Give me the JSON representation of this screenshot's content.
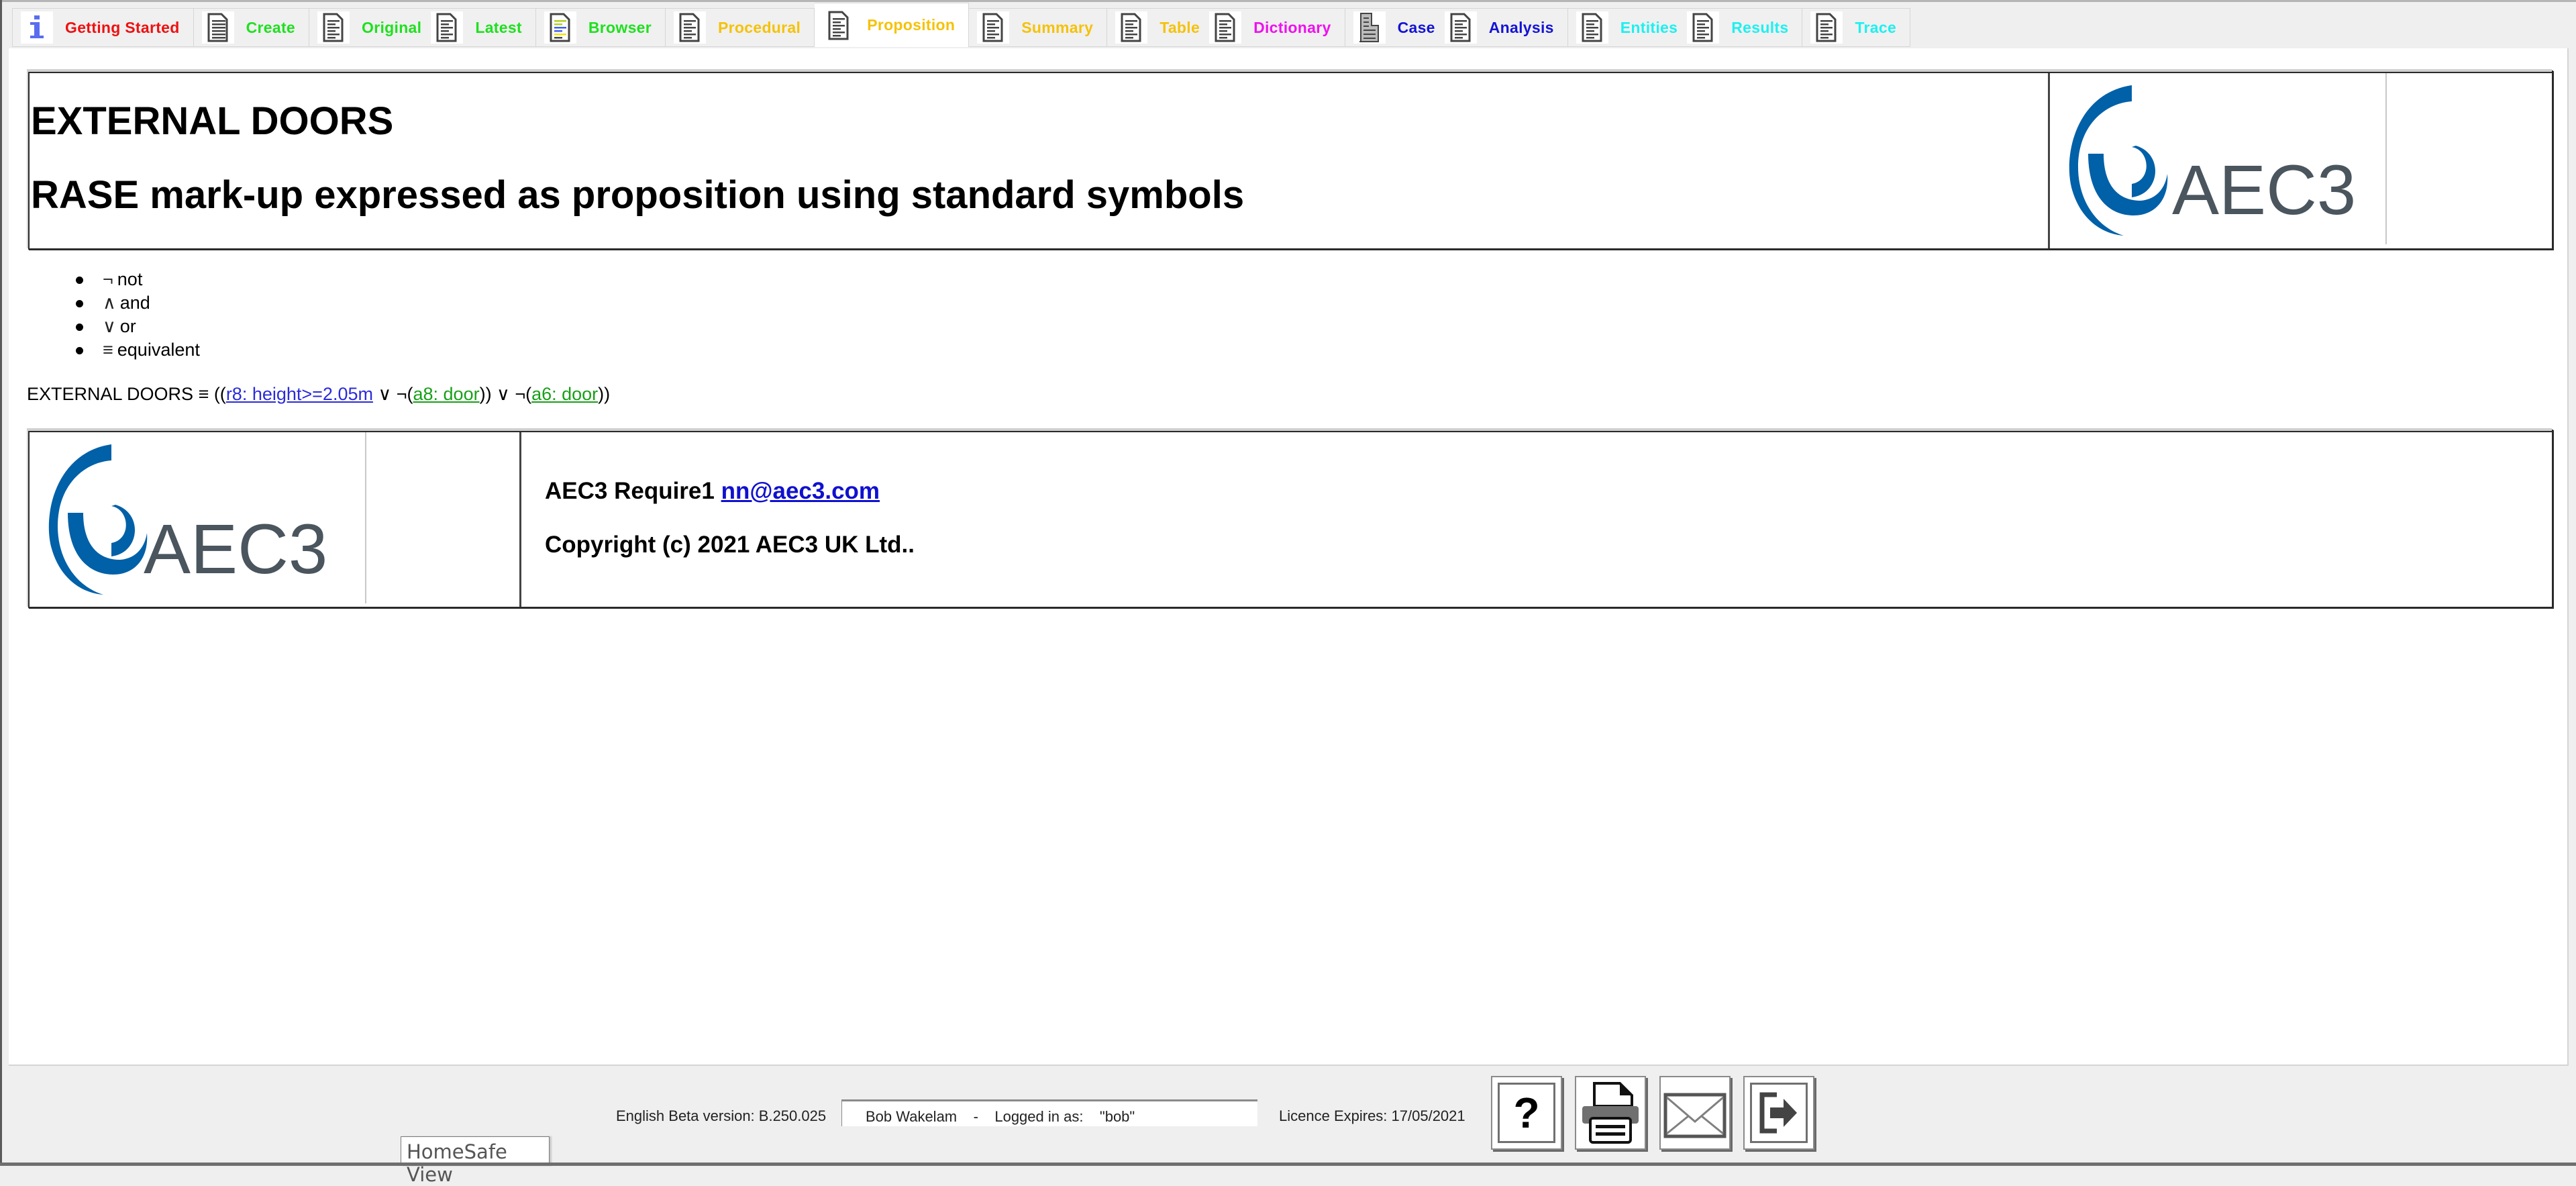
{
  "tabs": [
    {
      "label": "Getting Started",
      "icon": "info-icon",
      "color": "#ee1111",
      "group": 0
    },
    {
      "label": "Create",
      "icon": "calculator-document-icon",
      "color": "#1fe01f",
      "group": 1
    },
    {
      "label": "Original",
      "icon": "document-icon",
      "color": "#1fe01f",
      "group": 2
    },
    {
      "label": "Latest",
      "icon": "document-icon",
      "color": "#1fe01f",
      "group": 2
    },
    {
      "label": "Browser",
      "icon": "colored-document-icon",
      "color": "#1fe01f",
      "group": 3
    },
    {
      "label": "Procedural",
      "icon": "document-icon",
      "color": "#f5c20a",
      "group": 4
    },
    {
      "label": "Proposition",
      "icon": "document-icon",
      "color": "#f5c20a",
      "group": 5,
      "active": true
    },
    {
      "label": "Summary",
      "icon": "document-icon",
      "color": "#f5c20a",
      "group": 6
    },
    {
      "label": "Table",
      "icon": "table-document-icon",
      "color": "#f5c20a",
      "group": 7
    },
    {
      "label": "Dictionary",
      "icon": "dictionary-document-icon",
      "color": "#ee11ee",
      "group": 7
    },
    {
      "label": "Case",
      "icon": "building-icon",
      "color": "#1414d4",
      "group": 8
    },
    {
      "label": "Analysis",
      "icon": "analysis-document-icon",
      "color": "#1414d4",
      "group": 8
    },
    {
      "label": "Entities",
      "icon": "list-document-icon",
      "color": "#1ef0f0",
      "group": 9
    },
    {
      "label": "Results",
      "icon": "list-document-icon",
      "color": "#1ef0f0",
      "group": 9
    },
    {
      "label": "Trace",
      "icon": "list-document-icon",
      "color": "#1ef0f0",
      "group": 10
    }
  ],
  "header": {
    "title": "EXTERNAL DOORS",
    "subtitle": "RASE mark-up expressed as proposition using standard symbols",
    "logo_text": "AEC3"
  },
  "legend": [
    {
      "symbol": "¬",
      "meaning": "not"
    },
    {
      "symbol": "∧",
      "meaning": "and"
    },
    {
      "symbol": "∨",
      "meaning": "or"
    },
    {
      "symbol": "≡",
      "meaning": "equivalent"
    }
  ],
  "formula": {
    "name": "EXTERNAL DOORS",
    "equiv": " ≡ ((",
    "link1": "r8: height>=2.05m",
    "op1": " ∨ ¬(",
    "link2": "a8: door",
    "op2": ")) ∨ ¬(",
    "link3": "a6: door",
    "close": "))"
  },
  "footer": {
    "product": "AEC3 Require1 ",
    "email": "nn@aec3.com",
    "copyright": "Copyright (c) 2021 AEC3 UK Ltd..",
    "logo_text": "AEC3"
  },
  "status": {
    "version": "English Beta version: B.250.025",
    "user": "Bob Wakelam    -    Logged in as:    \"bob\"",
    "licence": "Licence Expires: 17/05/2021"
  },
  "toolbar": [
    {
      "name": "help-button",
      "icon": "question-icon"
    },
    {
      "name": "print-button",
      "icon": "printer-icon"
    },
    {
      "name": "email-button",
      "icon": "envelope-icon"
    },
    {
      "name": "exit-button",
      "icon": "exit-icon"
    }
  ],
  "bottom_tab": {
    "label": "HomeSafe View"
  },
  "colors": {
    "logo_blue": "#0060a8",
    "logo_gray": "#4a555e"
  }
}
